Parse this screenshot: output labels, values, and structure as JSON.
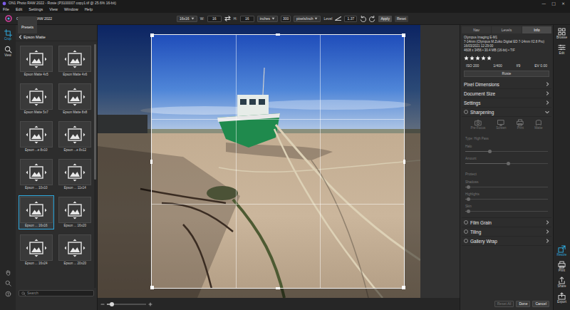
{
  "window": {
    "title": "ON1 Photo RAW 2022 - Rosie (P3100007 copy1.tif @ 25.6% 16-bit)",
    "controls": [
      "—",
      "□",
      "×"
    ]
  },
  "menu": [
    "File",
    "Edit",
    "Settings",
    "View",
    "Window",
    "Help"
  ],
  "app_name": "ON1 Photo RAW 2022",
  "toolbar": {
    "preset": "16x16",
    "w_label": "W:",
    "width": "16",
    "h_label": "H:",
    "height": "16",
    "units": "inches",
    "resolution": "300",
    "res_units": "pixels/inch",
    "level": "Level",
    "angle": "1.37",
    "apply": "Apply",
    "reset": "Reset"
  },
  "tools": [
    {
      "label": "Crop",
      "selected": true
    },
    {
      "label": "View",
      "selected": false
    }
  ],
  "presets": {
    "tab": "Presets",
    "folder": "Epson Matte",
    "items": [
      {
        "label": "Epson Matte 4x5",
        "selected": false
      },
      {
        "label": "Epson Matte 4x6",
        "selected": false
      },
      {
        "label": "Epson Matte 5x7",
        "selected": false
      },
      {
        "label": "Epson Matte 8x8",
        "selected": false
      },
      {
        "label": "Epson ...e 8x10",
        "selected": false
      },
      {
        "label": "Epson ...e 8x12",
        "selected": false
      },
      {
        "label": "Epson ... 10x10",
        "selected": false
      },
      {
        "label": "Epson ... 11x14",
        "selected": false
      },
      {
        "label": "Epson ... 16x16",
        "selected": true
      },
      {
        "label": "Epson ... 16x20",
        "selected": false
      },
      {
        "label": "Epson ... 16x24",
        "selected": false
      },
      {
        "label": "Epson ... 20x20",
        "selected": false
      }
    ],
    "search": {
      "placeholder": "Search"
    }
  },
  "canvas": {
    "zoom": {
      "level": 0.12
    }
  },
  "info_panel": {
    "tabs": [
      {
        "label": "Nav",
        "selected": false
      },
      {
        "label": "Levels",
        "selected": false
      },
      {
        "label": "Info",
        "selected": true
      }
    ],
    "camera": "Olympus Imaging E-M1",
    "lens": "7-14mm (Olympus M.Zuiko Digital ED 7-14mm f/2.8 Pro)",
    "date": "16/03/2021 12:29:00",
    "file": "4608 x 3456 • 30.4 MB (16-bit) • TIF",
    "stars": 5,
    "exposure": [
      "ISO 200",
      "1/400",
      "f/9",
      "EV 0.00"
    ],
    "name": "Rosie"
  },
  "sections": [
    {
      "title": "Pixel Dimensions",
      "kind": "plain",
      "expanded": false
    },
    {
      "title": "Document Size",
      "kind": "plain",
      "expanded": false
    },
    {
      "title": "Settings",
      "kind": "plain",
      "expanded": false
    },
    {
      "title": "Sharpening",
      "kind": "toggle",
      "on": false,
      "expanded": true
    },
    {
      "title": "Film Grain",
      "kind": "toggle",
      "on": false,
      "expanded": false
    },
    {
      "title": "Tiling",
      "kind": "toggle",
      "on": false,
      "expanded": false
    },
    {
      "title": "Gallery Wrap",
      "kind": "toggle",
      "on": false,
      "expanded": false
    }
  ],
  "sharpening": {
    "disabled": true,
    "presets": [
      {
        "label": "Pre-Focus",
        "selected": false
      },
      {
        "label": "Screen",
        "selected": false
      },
      {
        "label": "Print",
        "selected": false
      },
      {
        "label": "Matte",
        "selected": false
      }
    ],
    "type": "Type: High Pass",
    "sliders": [
      {
        "label": "Halo",
        "level": 0.3
      },
      {
        "label": "Amount",
        "level": 0.52
      }
    ],
    "protect": "Protect",
    "protect_sliders": [
      {
        "label": "Shadows",
        "level": 0.04
      },
      {
        "label": "Highlights",
        "level": 0.04
      },
      {
        "label": "Skin",
        "level": 0.04
      }
    ]
  },
  "actions": [
    {
      "label": "Reset All",
      "disabled": true
    },
    {
      "label": "Done",
      "disabled": false
    },
    {
      "label": "Cancel",
      "disabled": false
    }
  ],
  "modules": {
    "top": [
      {
        "label": "Browse",
        "selected": false
      },
      {
        "label": "Edit",
        "selected": false
      }
    ],
    "bottom": [
      {
        "label": "Resize",
        "selected": true
      },
      {
        "label": "Print",
        "selected": false
      },
      {
        "label": "Share",
        "selected": false
      },
      {
        "label": "Export",
        "selected": false
      }
    ]
  }
}
